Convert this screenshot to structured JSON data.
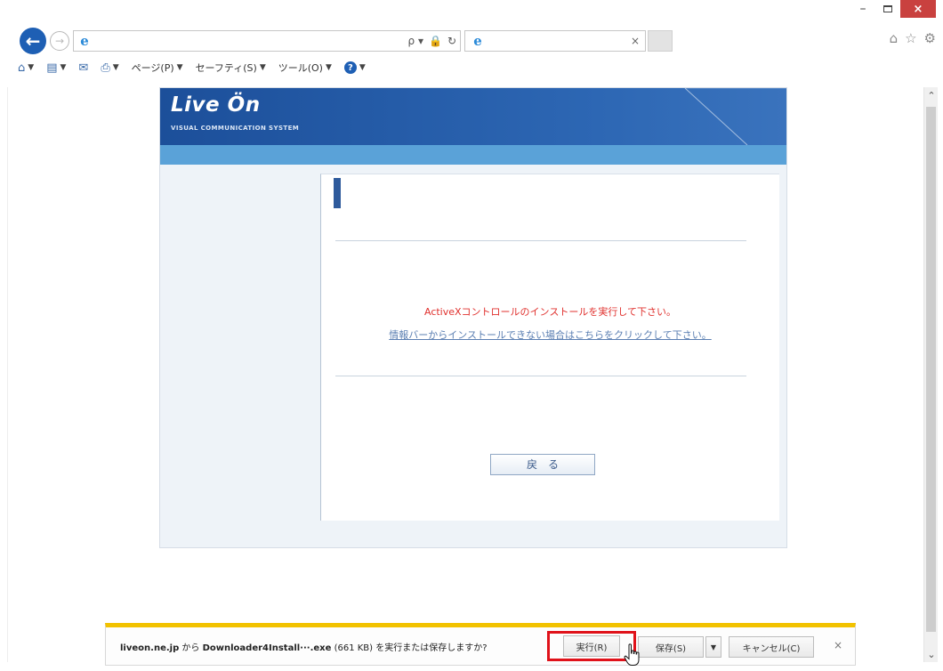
{
  "browser": {
    "address": {
      "value": "",
      "search_glyph": "ρ ▾",
      "lock_glyph": "🔒",
      "refresh_glyph": "↻"
    },
    "tab": {
      "title": "",
      "close": "×"
    },
    "window": {
      "minimize": "–",
      "close": "×"
    },
    "right_icons": {
      "home": "⌂",
      "favorites": "☆",
      "settings": "⚙"
    },
    "command_bar": {
      "page": "ページ(P)",
      "safety": "セーフティ(S)",
      "tools": "ツール(O)"
    }
  },
  "page": {
    "logo": "Live Ön",
    "logo_sub": "VISUAL COMMUNICATION SYSTEM",
    "message": "ActiveXコントロールのインストールを実行して下さい。",
    "link": "情報バーからインストールできない場合はこちらをクリックして下さい。",
    "back_button": "戻る"
  },
  "download_bar": {
    "site": "liveon.ne.jp",
    "from": " から ",
    "file": "Downloader4Install···.exe",
    "size": " (661 KB) ",
    "question": "を実行または保存しますか?",
    "run": "実行(R)",
    "save": "保存(S)",
    "dropdown": "▼",
    "cancel": "キャンセル(C)",
    "close": "×"
  },
  "colors": {
    "accent_blue": "#1e5fb4",
    "banner_blue": "#2d67b4",
    "message_red": "#e0312e",
    "highlight_red": "#e0121a",
    "notification_yellow": "#f2c200"
  }
}
